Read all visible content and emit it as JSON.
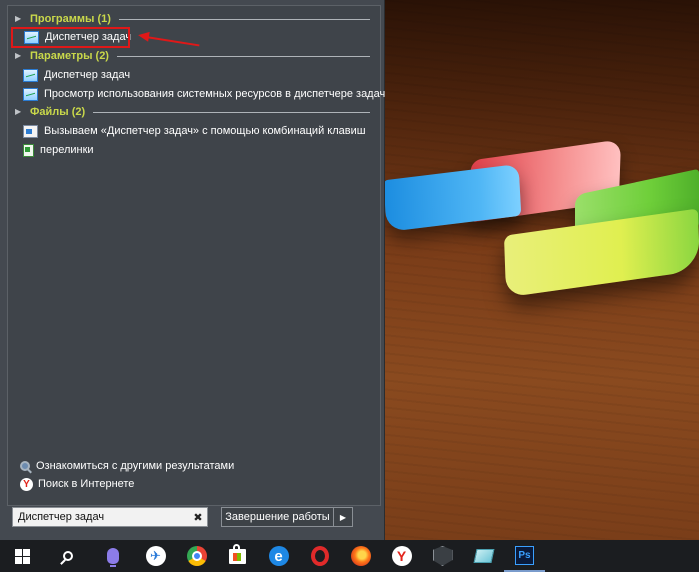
{
  "start_menu": {
    "groups": [
      {
        "header": "Программы (1)",
        "items": [
          {
            "label": "Диспетчер задач",
            "icon": "task-manager-icon"
          }
        ]
      },
      {
        "header": "Параметры (2)",
        "items": [
          {
            "label": "Диспетчер задач",
            "icon": "task-manager-icon"
          },
          {
            "label": "Просмотр использования системных ресурсов в диспетчере задач",
            "icon": "task-manager-icon"
          }
        ]
      },
      {
        "header": "Файлы (2)",
        "items": [
          {
            "label": "Вызываем «Диспетчер задач» с помощью комбинаций клавиш",
            "icon": "document-icon"
          },
          {
            "label": "перелинки",
            "icon": "spreadsheet-icon"
          }
        ]
      }
    ],
    "more_results_label": "Ознакомиться с другими результатами",
    "web_search_label": "Поиск в Интернете",
    "search": {
      "value": "Диспетчер задач",
      "clear_icon": "✖"
    },
    "shutdown_label": "Завершение работы",
    "shutdown_arrow": "▶",
    "highlight_color": "#e01818"
  },
  "taskbar": {
    "apps": [
      {
        "name": "start-button",
        "icon": "windows-logo-icon"
      },
      {
        "name": "search-button",
        "icon": "search-icon"
      },
      {
        "name": "cortana-button",
        "icon": "microphone-icon"
      },
      {
        "name": "app-travel",
        "icon": "plane-icon"
      },
      {
        "name": "app-chrome",
        "icon": "chrome-icon"
      },
      {
        "name": "app-store",
        "icon": "store-icon"
      },
      {
        "name": "app-edge",
        "icon": "edge-icon",
        "glyph": "e"
      },
      {
        "name": "app-opera",
        "icon": "opera-icon"
      },
      {
        "name": "app-firefox",
        "icon": "firefox-icon"
      },
      {
        "name": "app-yandex",
        "icon": "yandex-browser-icon",
        "glyph": "Y"
      },
      {
        "name": "app-world-of-tanks",
        "icon": "tanks-icon"
      },
      {
        "name": "app-notes",
        "icon": "notes-icon"
      },
      {
        "name": "app-photoshop",
        "icon": "photoshop-icon",
        "glyph": "Ps"
      }
    ]
  }
}
